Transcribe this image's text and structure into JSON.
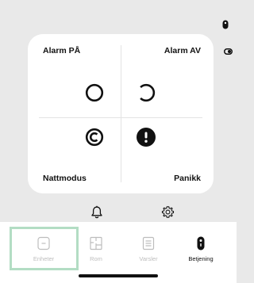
{
  "card": {
    "top_left_label": "Alarm PÅ",
    "top_right_label": "Alarm AV",
    "bottom_left_label": "Nattmodus",
    "bottom_right_label": "Panikk"
  },
  "actions": {
    "left_icon": "bell-icon",
    "right_icon": "gear-icon"
  },
  "nav": {
    "items": [
      {
        "label": "Enheter",
        "icon": "device-icon",
        "active": false
      },
      {
        "label": "Rom",
        "icon": "floorplan-icon",
        "active": false
      },
      {
        "label": "Varsler",
        "icon": "list-icon",
        "active": false
      },
      {
        "label": "Betjening",
        "icon": "keyfob-icon",
        "active": true
      }
    ]
  },
  "colors": {
    "background": "#e9e9e9",
    "highlight": "#b3ddc4",
    "icon": "#111111",
    "inactive": "#bdbdbd"
  }
}
